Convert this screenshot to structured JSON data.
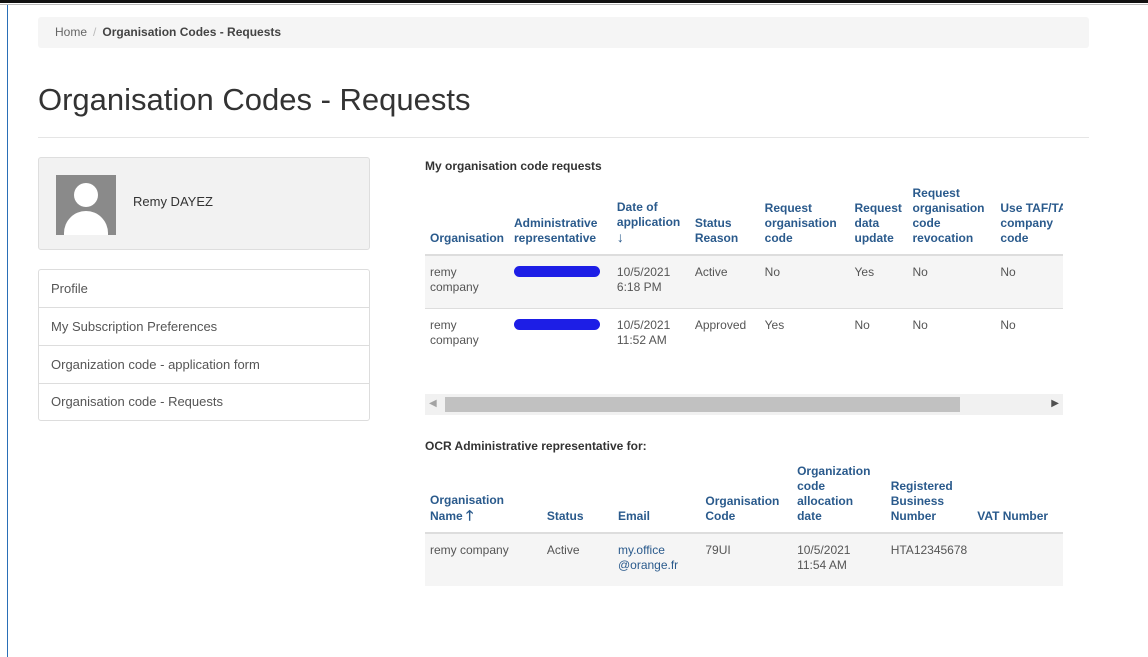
{
  "breadcrumb": {
    "home": "Home",
    "separator": "/",
    "current": "Organisation Codes - Requests"
  },
  "page": {
    "title": "Organisation Codes - Requests"
  },
  "profile": {
    "name": "Remy DAYEZ",
    "avatar_icon": "user-silhouette-icon"
  },
  "sidebar": {
    "items": [
      {
        "label": "Profile"
      },
      {
        "label": "My Subscription Preferences"
      },
      {
        "label": "Organization code - application form"
      },
      {
        "label": "Organisation code - Requests"
      }
    ]
  },
  "requests": {
    "title": "My organisation code requests",
    "headers": [
      "Organisation",
      "Administrative representative",
      "Date of application",
      "Status Reason",
      "Request organisation code",
      "Request data update",
      "Request organisation code revocation",
      "Use TAF/TAP company code"
    ],
    "sort_icon": "↓",
    "rows": [
      {
        "organisation": "remy company",
        "date": "10/5/2021 6:18 PM",
        "status": "Active",
        "request_code": "No",
        "data_update": "Yes",
        "revocation": "No",
        "use_code": "No"
      },
      {
        "organisation": "remy company",
        "date": "10/5/2021 11:52 AM",
        "status": "Approved",
        "request_code": "Yes",
        "data_update": "No",
        "revocation": "No",
        "use_code": "No"
      }
    ]
  },
  "scrollbar": {
    "left_arrow": "◀",
    "right_arrow": "▶"
  },
  "ocr": {
    "title": "OCR Administrative representative for:",
    "headers": [
      "Organisation Name",
      "Status",
      "Email",
      "Organisation Code",
      "Organization code allocation date",
      "Registered Business Number",
      "VAT Number"
    ],
    "sort_icon": "🡑",
    "rows": [
      {
        "name": "remy company",
        "status": "Active",
        "email_1": "my.office",
        "email_2": "@orange.fr",
        "code": "79UI",
        "date": "10/5/2021 11:54 AM",
        "business_number": "HTA12345678",
        "vat": ""
      }
    ]
  }
}
